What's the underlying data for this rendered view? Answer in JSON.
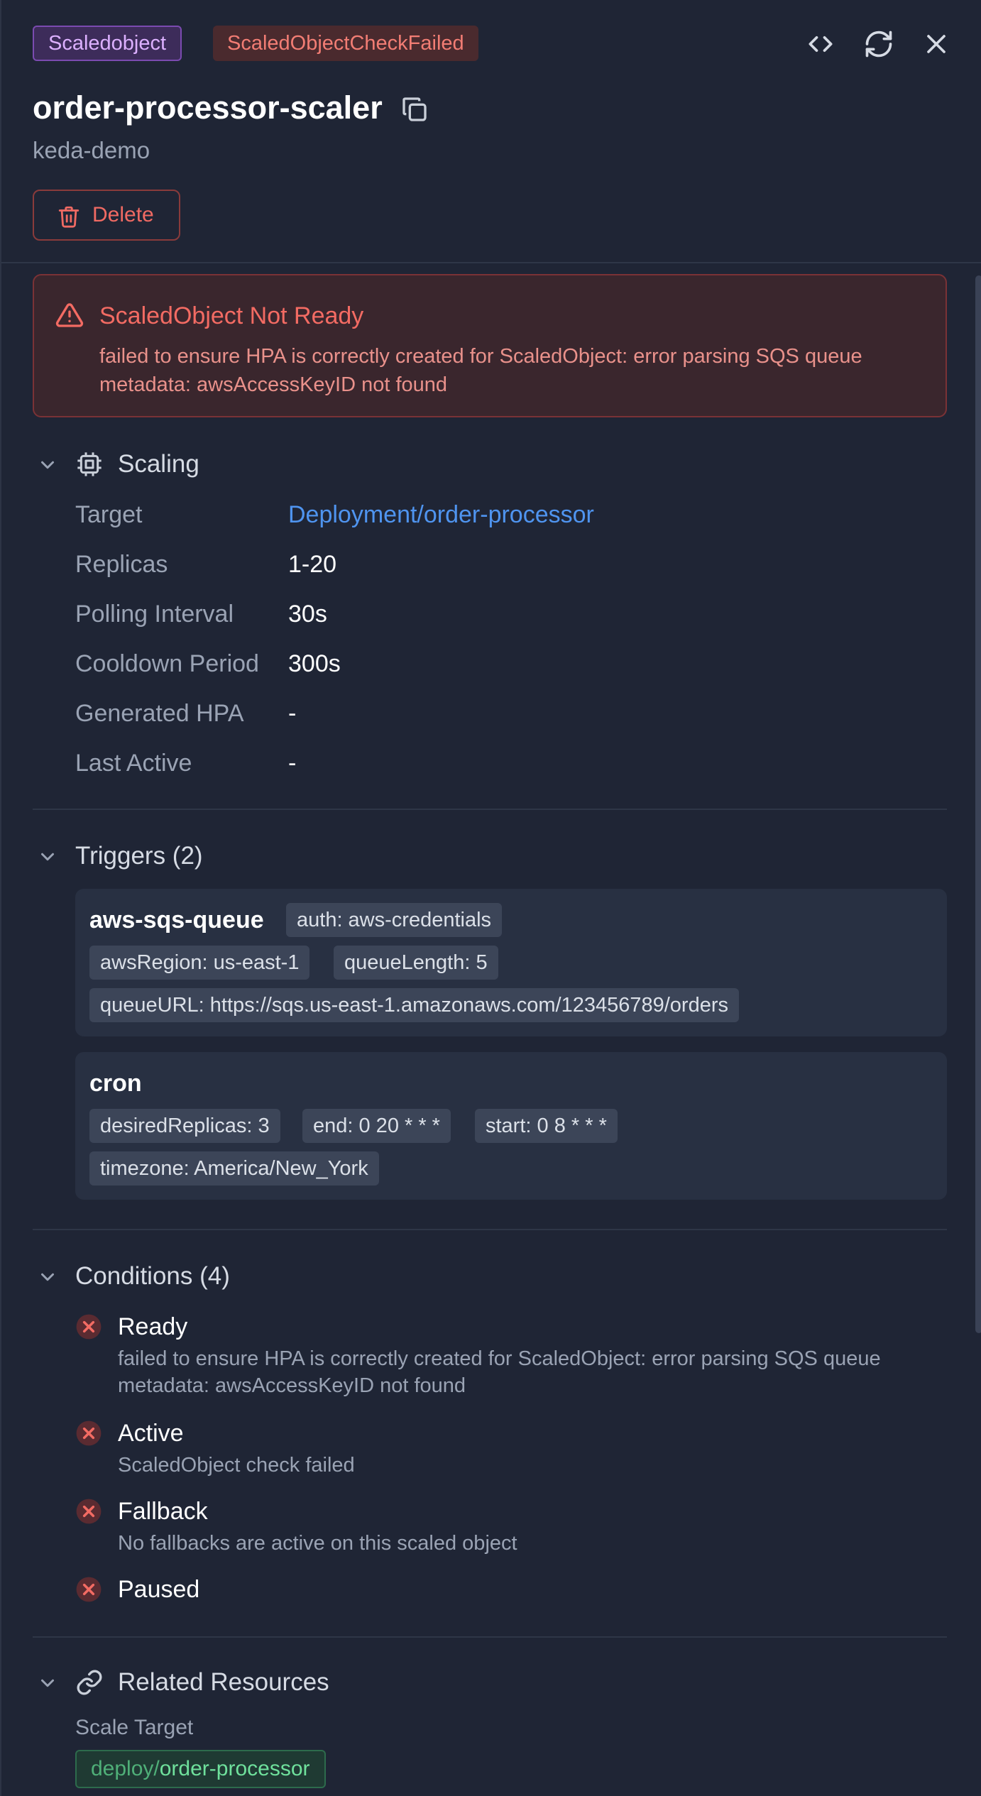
{
  "header": {
    "kind_badge": "Scaledobject",
    "status_badge": "ScaledObjectCheckFailed",
    "title": "order-processor-scaler",
    "namespace": "keda-demo",
    "delete_label": "Delete",
    "icons": [
      "code-icon",
      "refresh-icon",
      "close-icon",
      "copy-icon",
      "trash-icon"
    ]
  },
  "alert": {
    "title": "ScaledObject Not Ready",
    "message": "failed to ensure HPA is correctly created for ScaledObject: error parsing SQS queue metadata: awsAccessKeyID not found"
  },
  "scaling": {
    "title": "Scaling",
    "rows": [
      {
        "label": "Target",
        "value": "Deployment/order-processor"
      },
      {
        "label": "Replicas",
        "value": "1-20"
      },
      {
        "label": "Polling Interval",
        "value": "30s"
      },
      {
        "label": "Cooldown Period",
        "value": "300s"
      },
      {
        "label": "Generated HPA",
        "value": "-"
      },
      {
        "label": "Last Active",
        "value": "-"
      }
    ]
  },
  "triggers": {
    "title": "Triggers (2)",
    "items": [
      {
        "type": "aws-sqs-queue",
        "auth": "auth: aws-credentials",
        "chips": [
          "awsRegion: us-east-1",
          "queueLength: 5",
          "queueURL: https://sqs.us-east-1.amazonaws.com/123456789/orders"
        ]
      },
      {
        "type": "cron",
        "chips": [
          "desiredReplicas: 3",
          "end: 0 20 * * *",
          "start: 0 8 * * *",
          "timezone: America/New_York"
        ]
      }
    ]
  },
  "conditions": {
    "title": "Conditions (4)",
    "items": [
      {
        "name": "Ready",
        "message": "failed to ensure HPA is correctly created for ScaledObject: error parsing SQS queue metadata: awsAccessKeyID not found"
      },
      {
        "name": "Active",
        "message": "ScaledObject check failed"
      },
      {
        "name": "Fallback",
        "message": "No fallbacks are active on this scaled object"
      },
      {
        "name": "Paused",
        "message": ""
      }
    ]
  },
  "related": {
    "title": "Related Resources",
    "scale_target_label": "Scale Target",
    "chip_prefix": "deploy/",
    "chip_name": "order-processor"
  },
  "colors": {
    "background": "#1f2535",
    "accent_link": "#4f94ef",
    "error": "#f36b63",
    "kind_badge": "#dcb0ff",
    "related_green": "#6fe09c"
  }
}
